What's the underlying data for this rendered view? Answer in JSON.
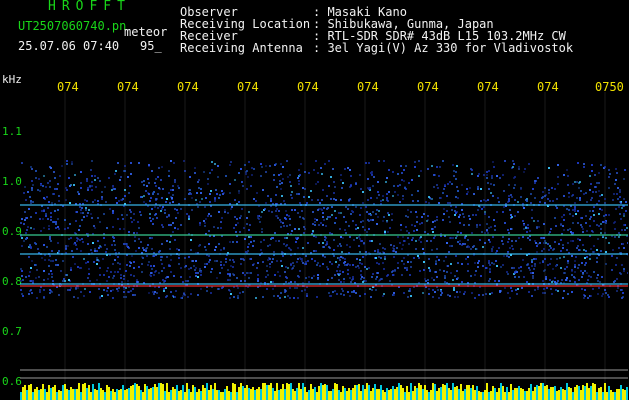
{
  "header": {
    "title": "HROFFT",
    "filename": "UT2507060740.pn",
    "file_ext": "meteor",
    "timestamp": "25.07.06 07:40",
    "count": "95_"
  },
  "info": [
    {
      "label": "Observer",
      "value": ": Masaki Kano"
    },
    {
      "label": "Receiving Location",
      "value": ": Shibukawa, Gunma, Japan"
    },
    {
      "label": "Receiver",
      "value": ": RTL-SDR SDR# 43dB L15 103.2MHz CW"
    },
    {
      "label": "Receiving Antenna",
      "value": ": 3el Yagi(V) Az 330 for Vladivostok"
    }
  ],
  "y_axis": {
    "unit": "kHz",
    "ticks": [
      "1.1",
      "1.0",
      "0.9",
      "0.8",
      "0.7",
      "0.6"
    ]
  },
  "x_axis": {
    "ticks": [
      "074",
      "074",
      "074",
      "074",
      "074",
      "074",
      "074",
      "074",
      "074",
      "0750"
    ]
  },
  "colors": {
    "background": "#000000",
    "label_green": "#19d619",
    "time_yellow": "#f0e000",
    "noise_blue": "#1e3cc8",
    "signal_cyan": "#3cc8ff",
    "signal_red": "#ff3030",
    "baseline_yellow": "#f0f000"
  }
}
